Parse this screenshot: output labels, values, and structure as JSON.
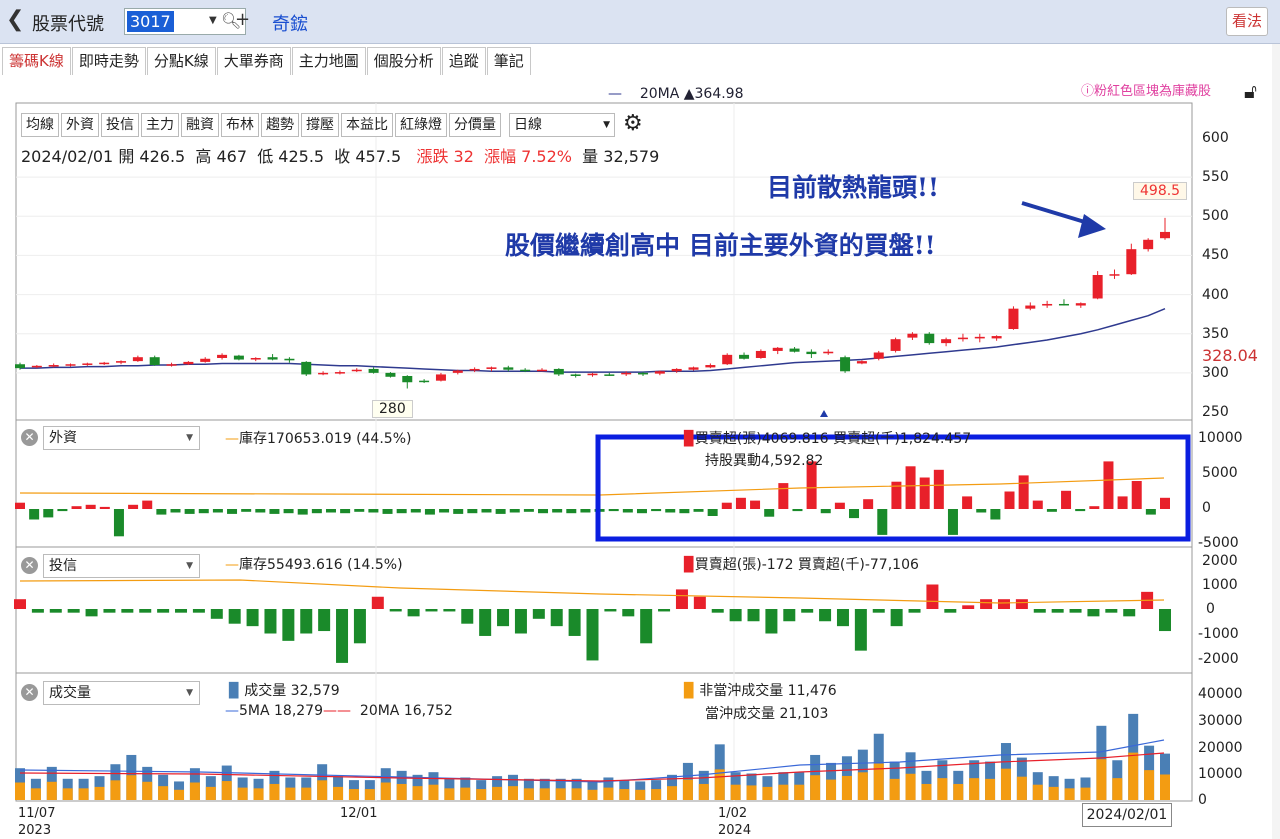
{
  "header": {
    "back_icon": "chevron-left-icon",
    "label": "股票代號",
    "code": "3017",
    "stock_name": "奇鋐",
    "view_button": "看法"
  },
  "tabs": [
    "籌碼K線",
    "即時走勢",
    "分點K線",
    "大單券商",
    "主力地圖",
    "個股分析",
    "追蹤",
    "筆記"
  ],
  "toolbar": {
    "buttons": [
      "均線",
      "外資",
      "投信",
      "主力",
      "融資",
      "布林",
      "趨勢",
      "撐壓",
      "本益比",
      "紅綠燈",
      "分價量"
    ],
    "period": "日線"
  },
  "ohlc": {
    "date": "2024/02/01",
    "open": "開 426.5",
    "high": "高 467",
    "low": "低 425.5",
    "close": "收 457.5",
    "change": "漲跌 32",
    "pct": "漲幅 7.52%",
    "volume": "量 32,579"
  },
  "ma_legend": "20MA ▲364.98",
  "top_legend": "ⓘ粉紅色區塊為庫藏股",
  "annotations": {
    "line1": "目前散熱龍頭!!",
    "line2": "股價繼續創高中 目前主要外資的買盤!!"
  },
  "price_labels": {
    "high": "498.5",
    "low": "280",
    "current": "328.04"
  },
  "price_axis": [
    "600",
    "550",
    "500",
    "450",
    "400",
    "350",
    "300",
    "250"
  ],
  "foreign": {
    "select": "外資",
    "inventory": "庫存170653.019 (44.5%)",
    "buysell": "買賣超(張)4069.816 買賣超(千)1,824.457",
    "holding_change": "持股異動4,592.82",
    "axis": [
      "10000",
      "5000",
      "0",
      "-5000"
    ]
  },
  "trust": {
    "select": "投信",
    "inventory": "庫存55493.616 (14.5%)",
    "buysell": "買賣超(張)-172 買賣超(千)-77,106",
    "axis": [
      "2000",
      "1000",
      "0",
      "-1000",
      "-2000"
    ]
  },
  "volume": {
    "select": "成交量",
    "vol": "成交量 32,579",
    "ma5": "5MA 18,279",
    "ma20": "20MA 16,752",
    "non_daytrade": "非當沖成交量 11,476",
    "daytrade": "當沖成交量 21,103",
    "axis": [
      "40000",
      "30000",
      "20000",
      "10000",
      "0"
    ]
  },
  "x_dates": {
    "d1": "11/07",
    "y1": "2023",
    "d2": "12/01",
    "d3": "1/02",
    "y3": "2024",
    "d4": "2024/02/01"
  },
  "colors": {
    "up": "#e8202a",
    "down": "#1a8a2a",
    "ma": "#2f3a8f",
    "orange": "#f39c12",
    "blue_vol": "#4a7fb5",
    "highlight": "#0a1ee0"
  },
  "chart_data": {
    "type": "candlestick",
    "ohlc": [
      [
        311,
        313,
        304,
        306
      ],
      [
        308,
        310,
        306,
        309
      ],
      [
        309,
        312,
        307,
        310
      ],
      [
        310,
        312,
        308,
        311
      ],
      [
        311,
        313,
        309,
        312
      ],
      [
        312,
        314,
        310,
        313
      ],
      [
        313,
        316,
        311,
        315
      ],
      [
        315,
        322,
        314,
        320
      ],
      [
        320,
        322,
        309,
        310
      ],
      [
        310,
        313,
        308,
        311
      ],
      [
        311,
        315,
        310,
        314
      ],
      [
        314,
        320,
        313,
        318
      ],
      [
        319,
        325,
        317,
        323
      ],
      [
        322,
        323,
        316,
        317
      ],
      [
        317,
        320,
        315,
        319
      ],
      [
        320,
        324,
        316,
        317
      ],
      [
        318,
        320,
        313,
        316
      ],
      [
        314,
        315,
        296,
        298
      ],
      [
        300,
        302,
        297,
        300
      ],
      [
        300,
        303,
        298,
        301
      ],
      [
        303,
        306,
        301,
        304
      ],
      [
        305,
        307,
        299,
        300
      ],
      [
        300,
        301,
        294,
        295
      ],
      [
        296,
        297,
        280,
        288
      ],
      [
        290,
        292,
        287,
        289
      ],
      [
        290,
        300,
        289,
        298
      ],
      [
        300,
        304,
        298,
        303
      ],
      [
        304,
        307,
        301,
        305
      ],
      [
        305,
        308,
        302,
        307
      ],
      [
        307,
        309,
        302,
        304
      ],
      [
        304,
        306,
        301,
        303
      ],
      [
        303,
        306,
        302,
        304
      ],
      [
        305,
        306,
        296,
        298
      ],
      [
        298,
        299,
        294,
        296
      ],
      [
        297,
        300,
        295,
        299
      ],
      [
        298,
        300,
        296,
        297
      ],
      [
        299,
        302,
        296,
        300
      ],
      [
        300,
        301,
        296,
        298
      ],
      [
        299,
        303,
        297,
        302
      ],
      [
        302,
        306,
        300,
        305
      ],
      [
        304,
        308,
        303,
        307
      ],
      [
        307,
        312,
        306,
        310
      ],
      [
        311,
        325,
        310,
        323
      ],
      [
        323,
        326,
        317,
        318
      ],
      [
        319,
        330,
        318,
        328
      ],
      [
        328,
        333,
        324,
        332
      ],
      [
        331,
        333,
        326,
        327
      ],
      [
        327,
        330,
        319,
        324
      ],
      [
        325,
        330,
        323,
        327
      ],
      [
        320,
        322,
        300,
        302
      ],
      [
        312,
        316,
        311,
        315
      ],
      [
        318,
        328,
        316,
        326
      ],
      [
        328,
        345,
        326,
        343
      ],
      [
        345,
        352,
        342,
        350
      ],
      [
        350,
        352,
        336,
        338
      ],
      [
        338,
        345,
        334,
        343
      ],
      [
        343,
        350,
        340,
        345
      ],
      [
        344,
        350,
        339,
        346
      ],
      [
        344,
        348,
        341,
        347
      ],
      [
        356,
        385,
        355,
        382
      ],
      [
        382,
        390,
        380,
        386
      ],
      [
        386,
        392,
        383,
        388
      ],
      [
        388,
        394,
        386,
        387
      ],
      [
        386,
        390,
        383,
        389
      ],
      [
        395,
        430,
        394,
        425
      ],
      [
        425,
        432,
        420,
        426
      ],
      [
        426,
        465,
        425,
        458
      ],
      [
        458,
        472,
        455,
        470
      ],
      [
        472,
        498,
        470,
        480
      ]
    ],
    "ma20": [
      306,
      306,
      307,
      307,
      308,
      308,
      309,
      309,
      310,
      310,
      311,
      311,
      312,
      312,
      312,
      312,
      312,
      311,
      310,
      309,
      309,
      308,
      307,
      306,
      305,
      304,
      303,
      303,
      302,
      302,
      302,
      302,
      301,
      301,
      301,
      301,
      301,
      301,
      302,
      302,
      302,
      303,
      305,
      307,
      309,
      311,
      313,
      314,
      315,
      316,
      317,
      319,
      321,
      323,
      325,
      327,
      329,
      331,
      333,
      336,
      339,
      342,
      346,
      350,
      355,
      361,
      367,
      373,
      382
    ],
    "foreign_buysell": [
      900,
      -1500,
      -1200,
      -300,
      400,
      600,
      300,
      -3900,
      600,
      1200,
      -800,
      -500,
      -700,
      -600,
      -500,
      -700,
      -400,
      -500,
      -700,
      -600,
      -800,
      -600,
      -500,
      -600,
      -400,
      -500,
      -700,
      -600,
      -500,
      -800,
      -500,
      -700,
      -600,
      -500,
      -700,
      -500,
      -400,
      -600,
      -500,
      -600,
      -500,
      -400,
      -300,
      -500,
      -600,
      -300,
      -500,
      -600,
      -400,
      -1000,
      900,
      1600,
      1200,
      -1100,
      3700,
      -300,
      6800,
      -600,
      900,
      -1300,
      1400,
      -3700,
      3900,
      6100,
      4500,
      5600,
      -3700,
      1800,
      -500,
      -1500,
      2500,
      4800,
      1200,
      -400,
      2600,
      -300,
      400,
      6800,
      1800,
      4000,
      -800,
      1600
    ],
    "trust_buysell": [
      400,
      -150,
      -150,
      -150,
      -300,
      -150,
      -150,
      -150,
      -150,
      -150,
      -150,
      -400,
      -600,
      -700,
      -1000,
      -1300,
      -1000,
      -900,
      -2200,
      -1400,
      500,
      -100,
      -300,
      -100,
      -100,
      -600,
      -1100,
      -700,
      -1000,
      -400,
      -700,
      -1100,
      -2100,
      -100,
      -300,
      -1400,
      -100,
      800,
      500,
      -150,
      -500,
      -500,
      -1000,
      -500,
      -150,
      -500,
      -700,
      -1700,
      -150,
      -700,
      -150,
      1000,
      -150,
      150,
      400,
      400,
      400,
      -150,
      -150,
      -150,
      -300,
      -150,
      -300,
      700,
      -900
    ],
    "volume_total": [
      12000,
      8000,
      12500,
      8000,
      8000,
      9000,
      13500,
      17000,
      12500,
      9500,
      7000,
      12000,
      9000,
      13000,
      8500,
      8000,
      11000,
      8500,
      8500,
      13500,
      9000,
      7500,
      7500,
      12000,
      11000,
      9500,
      10500,
      8000,
      8500,
      7500,
      9000,
      9500,
      8000,
      8000,
      8000,
      8000,
      7000,
      8500,
      7500,
      7000,
      7500,
      9500,
      14000,
      11000,
      21000,
      10500,
      10000,
      9000,
      10500,
      10500,
      17000,
      14000,
      16500,
      19000,
      25000,
      14500,
      18000,
      11000,
      15000,
      11000,
      15000,
      14500,
      21500,
      16000,
      10500,
      9000,
      8000,
      8500,
      28000,
      15000,
      32500,
      20500,
      17500
    ]
  }
}
